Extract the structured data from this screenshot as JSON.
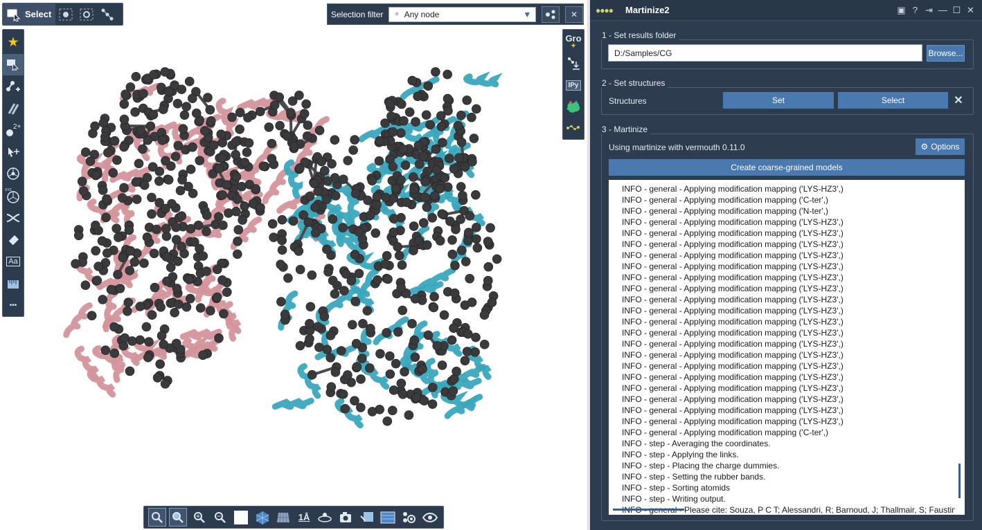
{
  "viewport": {
    "select_toolbar": {
      "select_label": "Select"
    },
    "selection_filter": {
      "label": "Selection filter",
      "value": "Any node"
    },
    "left_toolbar": {
      "icons": [
        "star-icon",
        "select-rect-icon",
        "add-atoms-icon",
        "bond-tool-icon",
        "charge-icon",
        "move-icon",
        "rotate-icon",
        "xyz-icon",
        "swap-icon",
        "eraser-icon",
        "text-label-icon",
        "ruler-icon",
        "more-icon"
      ],
      "charge_text": "2+",
      "xyz_text": "XYZ",
      "text_label": "Aa",
      "more_text": "•••"
    },
    "right_toolbar": {
      "gro_label": "Gro",
      "ipy_label": "IPy"
    },
    "bottom_toolbar": {
      "angstrom_label": "1Å"
    },
    "colors": {
      "chain_a": "#d4939b",
      "chain_b": "#3aa6bd",
      "atoms": "#3a3a3c"
    }
  },
  "panel": {
    "title": "Martinize2",
    "section1": {
      "title": "1 - Set results folder",
      "folder_value": "D:/Samples/CG",
      "browse_label": "Browse..."
    },
    "section2": {
      "title": "2 - Set structures",
      "structures_label": "Structures",
      "set_label": "Set",
      "select_label": "Select"
    },
    "section3": {
      "title": "3 - Martinize",
      "using_label": "Using martinize with vermouth 0.11.0",
      "options_label": "Options",
      "create_label": "Create coarse-grained models",
      "log": [
        "INFO - general - Applying modification mapping ('LYS-HZ3',)",
        "INFO - general - Applying modification mapping ('C-ter',)",
        "INFO - general - Applying modification mapping ('N-ter',)",
        "INFO - general - Applying modification mapping ('LYS-HZ3',)",
        "INFO - general - Applying modification mapping ('LYS-HZ3',)",
        "INFO - general - Applying modification mapping ('LYS-HZ3',)",
        "INFO - general - Applying modification mapping ('LYS-HZ3',)",
        "INFO - general - Applying modification mapping ('LYS-HZ3',)",
        "INFO - general - Applying modification mapping ('LYS-HZ3',)",
        "INFO - general - Applying modification mapping ('LYS-HZ3',)",
        "INFO - general - Applying modification mapping ('LYS-HZ3',)",
        "INFO - general - Applying modification mapping ('LYS-HZ3',)",
        "INFO - general - Applying modification mapping ('LYS-HZ3',)",
        "INFO - general - Applying modification mapping ('LYS-HZ3',)",
        "INFO - general - Applying modification mapping ('LYS-HZ3',)",
        "INFO - general - Applying modification mapping ('LYS-HZ3',)",
        "INFO - general - Applying modification mapping ('LYS-HZ3',)",
        "INFO - general - Applying modification mapping ('LYS-HZ3',)",
        "INFO - general - Applying modification mapping ('LYS-HZ3',)",
        "INFO - general - Applying modification mapping ('LYS-HZ3',)",
        "INFO - general - Applying modification mapping ('LYS-HZ3',)",
        "INFO - general - Applying modification mapping ('LYS-HZ3',)",
        "INFO - general - Applying modification mapping ('C-ter',)",
        "INFO - step - Averaging the coordinates.",
        "INFO - step - Applying the links.",
        "INFO - step - Placing the charge dummies.",
        "INFO - step - Setting the rubber bands.",
        "INFO - step - Sorting atomids",
        "INFO - step - Writing output.",
        "INFO - general - Please cite: Souza, P C T; Alessandri, R; Barnoud, J; Thallmair, S; Faustino, I;"
      ]
    }
  }
}
